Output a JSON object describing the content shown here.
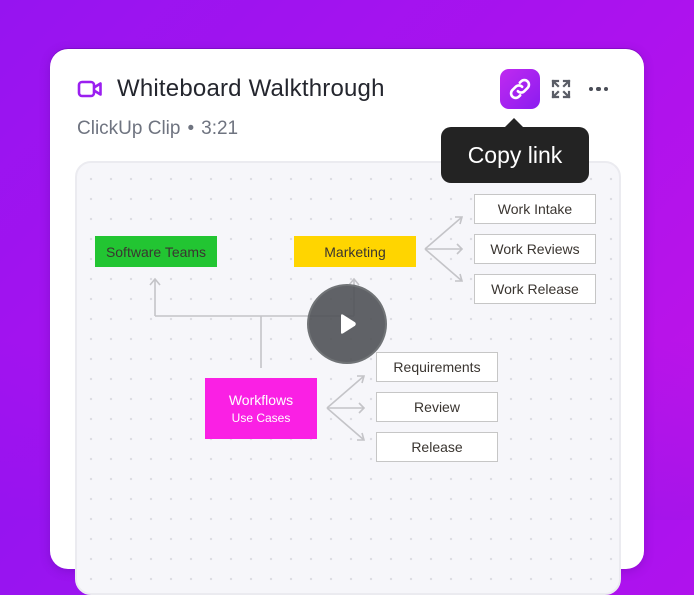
{
  "card": {
    "title": "Whiteboard Walkthrough",
    "subtitle_source": "ClickUp Clip",
    "subtitle_separator": "•",
    "duration": "3:21",
    "title_icon": "video-camera-icon"
  },
  "actions": {
    "copy_link_icon": "link-icon",
    "expand_icon": "expand-icon",
    "more_icon": "more-horizontal-icon"
  },
  "tooltip": {
    "text": "Copy link"
  },
  "colors": {
    "accent": "#9b1ff0",
    "software_teams": "#22c532",
    "marketing": "#ffd500",
    "workflows": "#fa20e4"
  },
  "whiteboard": {
    "software_teams": "Software Teams",
    "marketing": "Marketing",
    "workflows": {
      "title": "Workflows",
      "subtitle": "Use Cases"
    },
    "marketing_children": [
      "Work Intake",
      "Work Reviews",
      "Work Release"
    ],
    "workflow_children": [
      "Requirements",
      "Review",
      "Release"
    ]
  },
  "player": {
    "play_icon": "play-icon"
  }
}
